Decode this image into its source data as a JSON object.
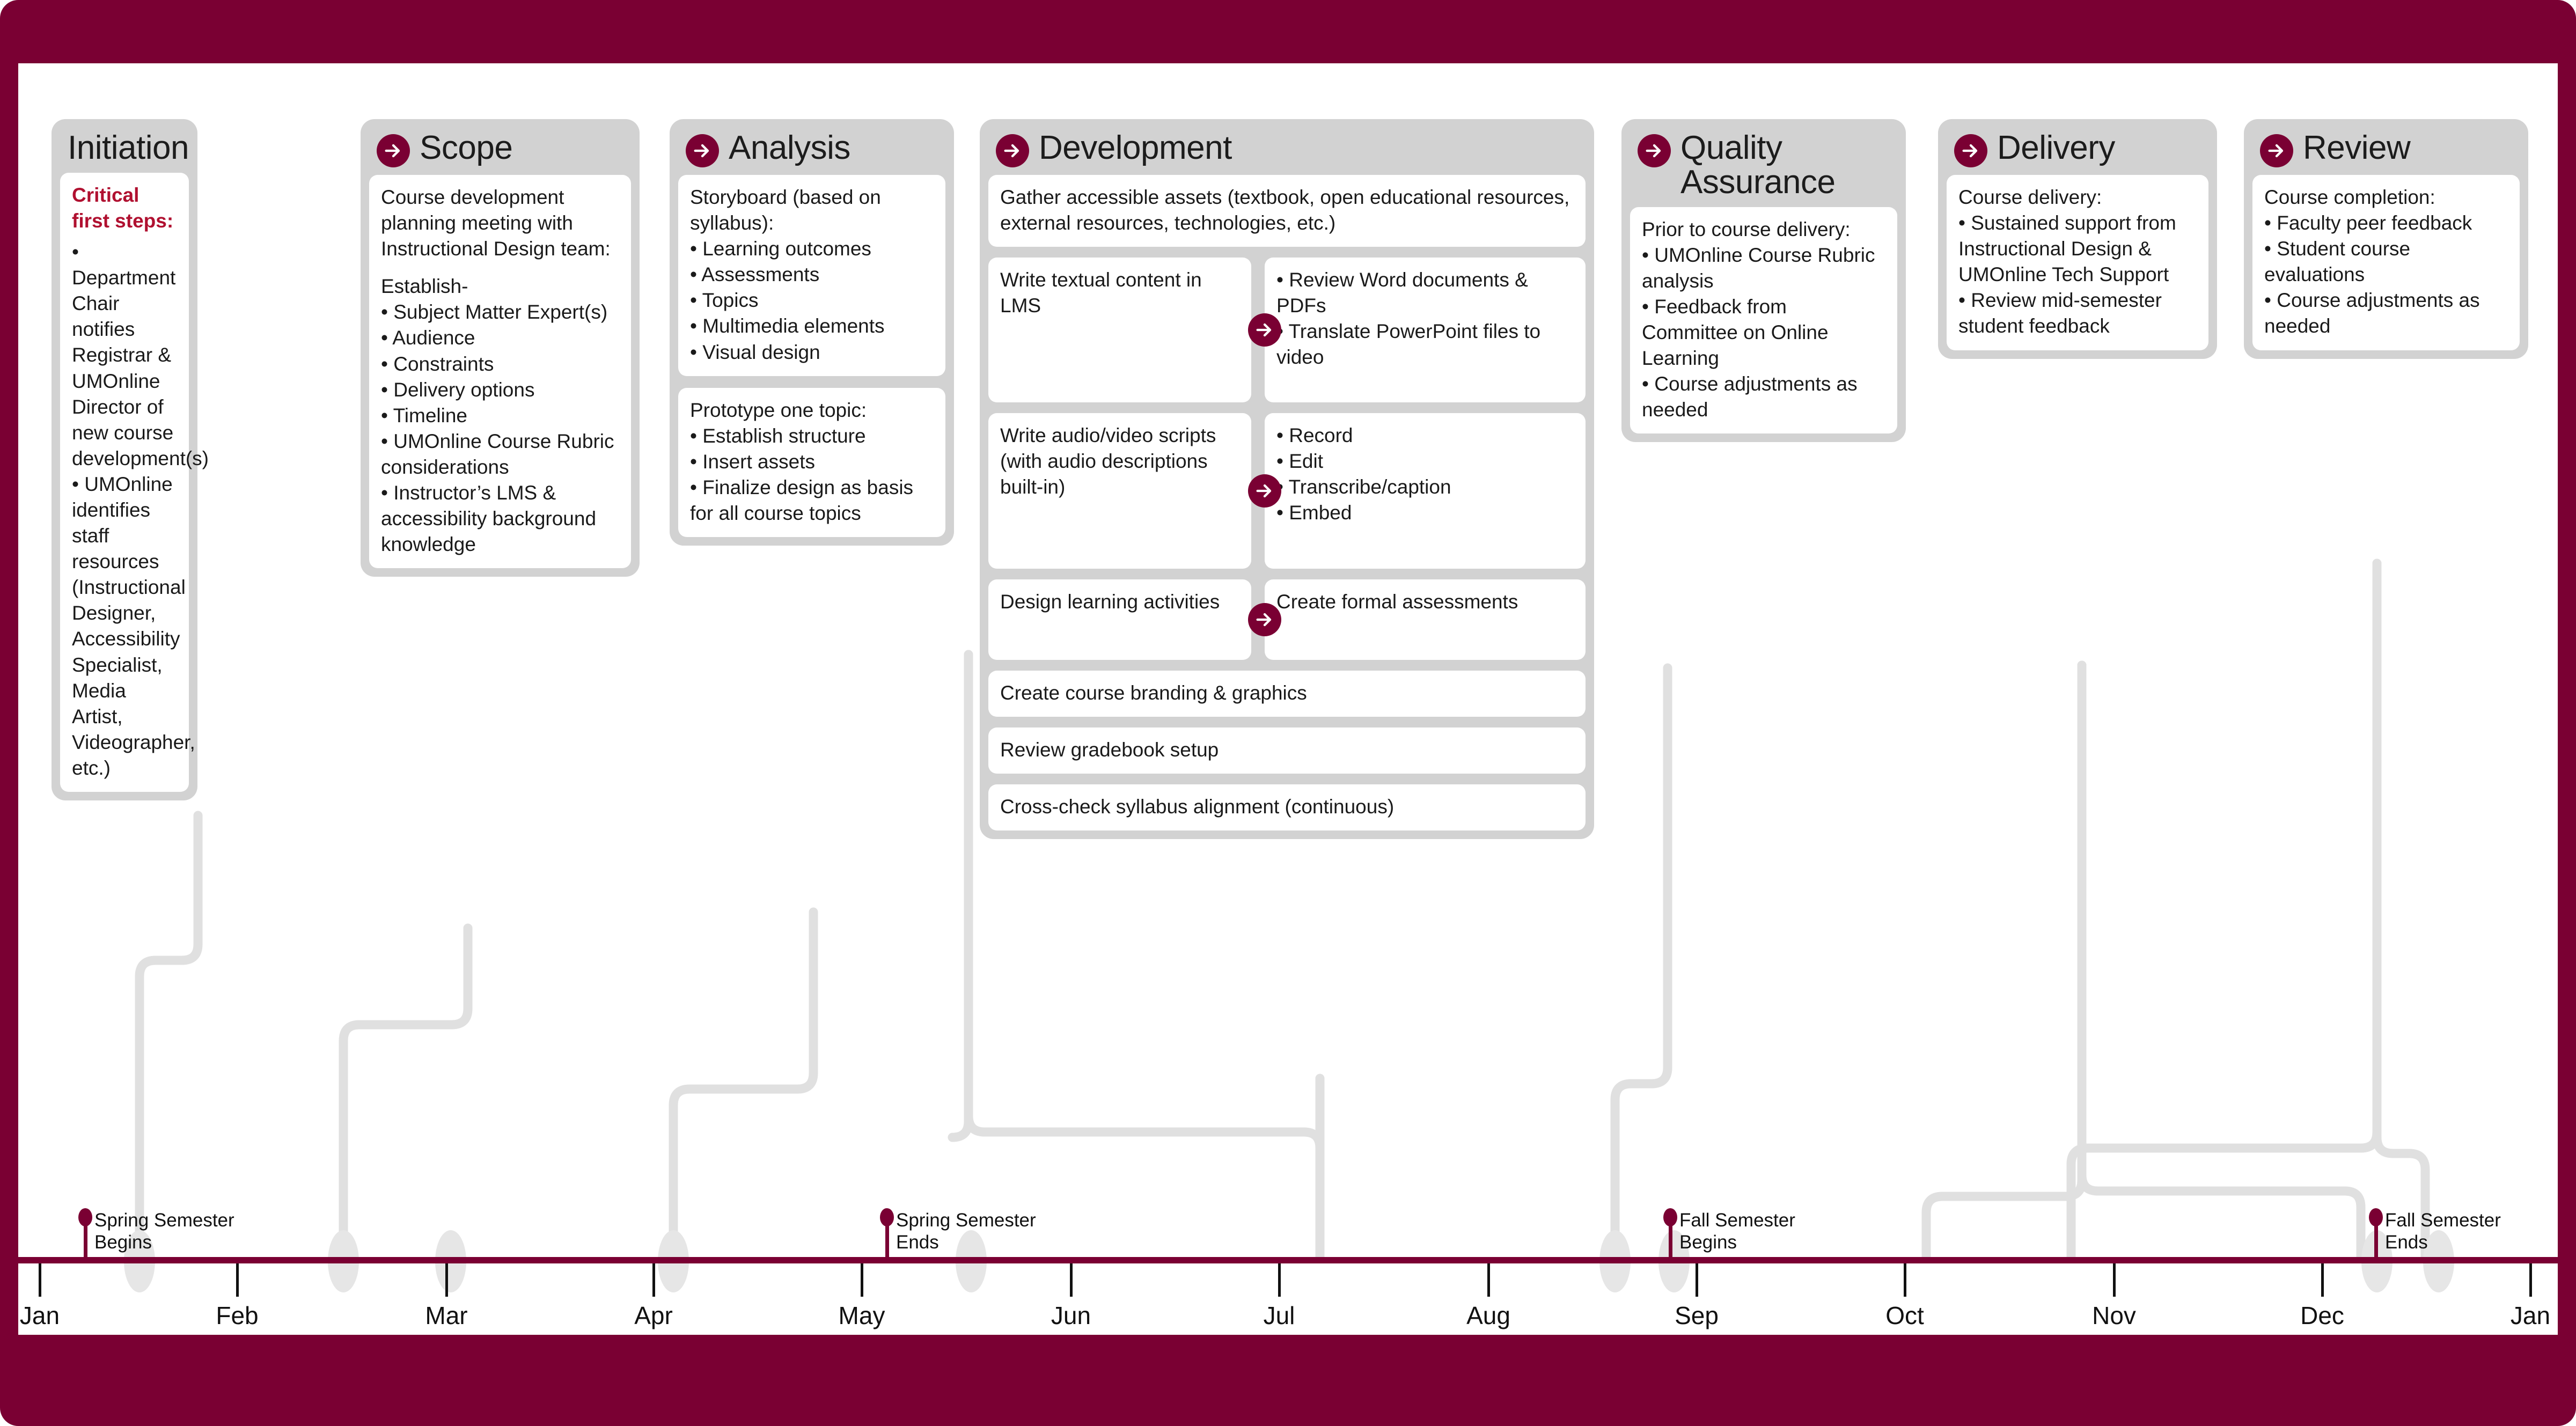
{
  "theme": {
    "maroon": "#7A0033",
    "card_gray": "#d2d2d2",
    "panel_white": "#ffffff",
    "wire_gray": "#e0e0e0",
    "critical_red": "#B01030"
  },
  "phases": [
    {
      "id": "initiation",
      "title": "Initiation",
      "has_badge": false,
      "panels": [
        {
          "blocks": [
            {
              "style": "critical",
              "text": "Critical first steps:"
            },
            {
              "style": "body",
              "text": "• Department Chair notifies Registrar & UMOnline Director of new course development(s)"
            },
            {
              "style": "body",
              "text": "• UMOnline identifies staff resources (Instructional Designer, Accessibility Specialist, Media Artist, Videographer, etc.)"
            }
          ]
        }
      ]
    },
    {
      "id": "scope",
      "title": "Scope",
      "has_badge": true,
      "panels": [
        {
          "blocks": [
            {
              "style": "body",
              "text": "Course development planning meeting with Instructional Design team:"
            },
            {
              "style": "body-gap",
              "text": "Establish-"
            },
            {
              "style": "body",
              "text": "• Subject Matter Expert(s)"
            },
            {
              "style": "body",
              "text": "• Audience"
            },
            {
              "style": "body",
              "text": "• Constraints"
            },
            {
              "style": "body",
              "text": "• Delivery options"
            },
            {
              "style": "body",
              "text": "• Timeline"
            },
            {
              "style": "body",
              "text": "• UMOnline Course Rubric considerations"
            },
            {
              "style": "body",
              "text": "• Instructor’s LMS & accessibility background knowledge"
            }
          ]
        }
      ]
    },
    {
      "id": "analysis",
      "title": "Analysis",
      "has_badge": true,
      "panels": [
        {
          "blocks": [
            {
              "style": "body",
              "text": "Storyboard (based on syllabus):"
            },
            {
              "style": "body",
              "text": "• Learning outcomes"
            },
            {
              "style": "body",
              "text": "• Assessments"
            },
            {
              "style": "body",
              "text": "• Topics"
            },
            {
              "style": "body",
              "text": "• Multimedia elements"
            },
            {
              "style": "body",
              "text": "• Visual design"
            }
          ]
        },
        {
          "blocks": [
            {
              "style": "body",
              "text": "Prototype one topic:"
            },
            {
              "style": "body",
              "text": "• Establish structure"
            },
            {
              "style": "body",
              "text": "• Insert assets"
            },
            {
              "style": "body",
              "text": "• Finalize design as basis for all course topics"
            }
          ]
        }
      ]
    },
    {
      "id": "development",
      "title": "Development",
      "has_badge": true,
      "rows": [
        {
          "type": "single",
          "text": "Gather accessible assets (textbook, open educational resources, external resources, technologies, etc.)"
        },
        {
          "type": "pair",
          "left": "Write textual content in LMS",
          "right": "• Review Word documents & PDFs\n• Translate PowerPoint files to video"
        },
        {
          "type": "pair",
          "left": "Write audio/video scripts (with audio descriptions built-in)",
          "right": "• Record\n• Edit\n• Transcribe/caption\n• Embed"
        },
        {
          "type": "pair",
          "left": "Design learning activities",
          "right": "Create formal assessments"
        },
        {
          "type": "single",
          "text": "Create course branding & graphics"
        },
        {
          "type": "single",
          "text": "Review gradebook setup"
        },
        {
          "type": "single",
          "text": "Cross-check syllabus alignment (continuous)"
        }
      ]
    },
    {
      "id": "quality-assurance",
      "title": "Quality Assurance",
      "has_badge": true,
      "panels": [
        {
          "blocks": [
            {
              "style": "body",
              "text": "Prior to course delivery:"
            },
            {
              "style": "body",
              "text": "• UMOnline Course Rubric analysis"
            },
            {
              "style": "body",
              "text": "• Feedback from Committee on Online Learning"
            },
            {
              "style": "body",
              "text": "• Course adjustments as needed"
            }
          ]
        }
      ]
    },
    {
      "id": "delivery",
      "title": "Delivery",
      "has_badge": true,
      "panels": [
        {
          "blocks": [
            {
              "style": "body",
              "text": "Course delivery:"
            },
            {
              "style": "body",
              "text": "• Sustained support from Instructional Design & UMOnline Tech Support"
            },
            {
              "style": "body",
              "text": "• Review mid-semester student feedback"
            }
          ]
        }
      ]
    },
    {
      "id": "review",
      "title": "Review",
      "has_badge": true,
      "panels": [
        {
          "blocks": [
            {
              "style": "body",
              "text": "Course completion:"
            },
            {
              "style": "body",
              "text": "• Faculty peer feedback"
            },
            {
              "style": "body",
              "text": "• Student course evaluations"
            },
            {
              "style": "body",
              "text": "• Course adjustments as needed"
            }
          ]
        }
      ]
    }
  ],
  "timeline": {
    "months": [
      "Jan",
      "Feb",
      "Mar",
      "Apr",
      "May",
      "Jun",
      "Jul",
      "Aug",
      "Sep",
      "Oct",
      "Nov",
      "Dec",
      "Jan"
    ],
    "markers": [
      {
        "id": "spring-begins",
        "line1": "Spring Semester",
        "line2": "Begins"
      },
      {
        "id": "spring-ends",
        "line1": "Spring Semester",
        "line2": "Ends"
      },
      {
        "id": "fall-begins",
        "line1": "Fall Semester",
        "line2": "Begins"
      },
      {
        "id": "fall-ends",
        "line1": "Fall Semester",
        "line2": "Ends"
      }
    ]
  }
}
